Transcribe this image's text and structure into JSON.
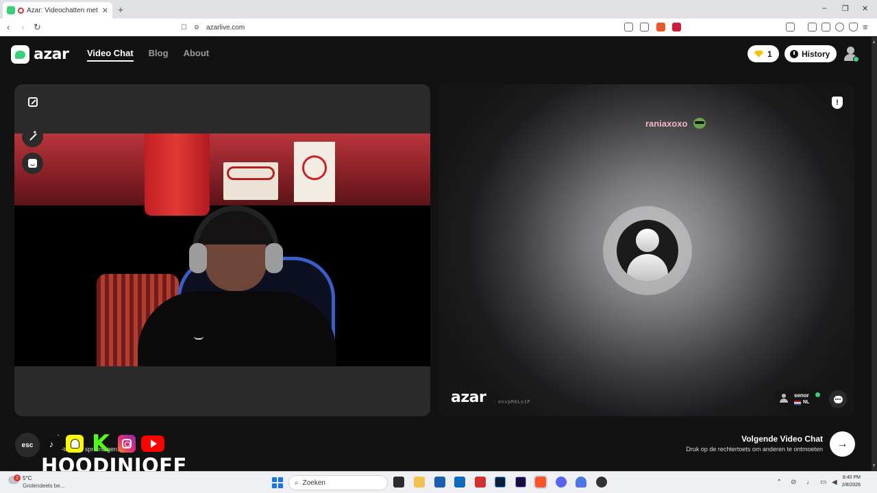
{
  "browser": {
    "tab_title": "Azar: Videochatten met nieuwe",
    "tab_close": "✕",
    "new_tab": "+",
    "url": "azarlive.com",
    "window_controls": [
      "–",
      "❐",
      "✕"
    ]
  },
  "header": {
    "logo_text": "azar",
    "nav": [
      {
        "label": "Video Chat",
        "active": true
      },
      {
        "label": "Blog",
        "active": false
      },
      {
        "label": "About",
        "active": false
      }
    ],
    "gems_count": "1",
    "history_label": "History"
  },
  "left_panel": {
    "tools": [
      "expand-icon",
      "magic-wand-icon",
      "face-filter-icon"
    ]
  },
  "right_panel": {
    "partner_name": "raniaxoxo",
    "report_label": "!",
    "watermark_logo": "azar",
    "watermark_id": "envpR6Lo1P",
    "user_chip": {
      "name": "senor",
      "country": "NL"
    }
  },
  "bottom": {
    "esc_label": "esc",
    "esc_title": "ind",
    "esc_desc": "k op      -to     de vi     spre      ndigen.",
    "next_title": "Volgende Video Chat",
    "next_desc": "Druk op de rechtertoets om anderen te ontmoeten",
    "next_arrow": "→"
  },
  "overlay": {
    "streamer_name": "HOODINIOFF",
    "tiktok_glyph": "♪",
    "kick_glyph": "K"
  },
  "taskbar": {
    "weather_badge": "2",
    "weather_temp": "5°C",
    "weather_desc": "Grotendeels be...",
    "search_placeholder": "Zoeken",
    "time": "8:40 PM",
    "date": "2/8/2026"
  },
  "colors": {
    "accent_green": "#3ad17a",
    "page_bg": "#121212",
    "partner_name": "#f2b6c6"
  }
}
